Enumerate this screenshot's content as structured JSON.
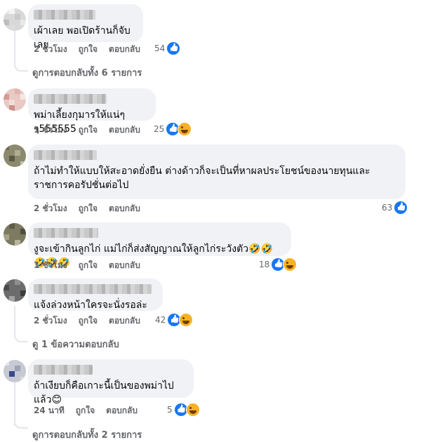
{
  "comments": [
    {
      "text": "เผ้าเลย พอเปิดร้านก็จับเลย",
      "time": "2 ชั่วโมง",
      "like": "ถูกใจ",
      "reply": "ตอบกลับ",
      "count": "54",
      "reactions": [
        "like-icon"
      ]
    },
    {
      "text": "พม่าเลี้ยงกุมารให้แน่ๆๆ555555",
      "time": "1 ชั่วโมง",
      "like": "ถูกใจ",
      "reply": "ตอบกลับ",
      "count": "25",
      "reactions": [
        "like-icon",
        "haha-icon"
      ]
    },
    {
      "text": "ถ้าไม่ทำให้แบบให้สะอาดยั่งยืน ต่างด้าวก็จะเป็นที่หาผลประโยชน์ของนายทุนและราชการคอรัปชั่นต่อไป",
      "time": "2 ชั่วโมง",
      "like": "ถูกใจ",
      "reply": "ตอบกลับ",
      "count": "63",
      "reactions": [
        "like-icon"
      ]
    },
    {
      "text": "งูจะเข้ากินลูกไก่ แม่ไก่ก็ส่งสัญญาณให้ลูกไก่ระวังตัว🤣🤣🤣🤣🤣",
      "time": "1 ชั่วโมง",
      "like": "ถูกใจ",
      "reply": "ตอบกลับ",
      "count": "18",
      "reactions": [
        "like-icon",
        "haha-icon"
      ]
    },
    {
      "text": "แจ้งล่วงหน้าใครจะนั่งรอล่ะ",
      "time": "2 ชั่วโมง",
      "like": "ถูกใจ",
      "reply": "ตอบกลับ",
      "count": "42",
      "reactions": [
        "like-icon",
        "haha-icon"
      ]
    },
    {
      "text": "ถ้าเงียบก็คือเกาะนี้เป็นของพม่าไปแล้ว😊",
      "time": "24 นาที",
      "like": "ถูกใจ",
      "reply": "ตอบกลับ",
      "count": "5",
      "reactions": [
        "like-icon",
        "haha-icon"
      ]
    }
  ],
  "view_replies": {
    "first": "ดูการตอบกลับทั้ง 6 รายการ",
    "second": "ดู 1 ข้อความตอบกลับ",
    "third": "ดูการตอบกลับทั้ง 2 รายการ"
  },
  "colors": {
    "bubble": "#f0f2f5",
    "meta": "#65676b",
    "like": "#1877f2",
    "haha": "#f7b125"
  }
}
